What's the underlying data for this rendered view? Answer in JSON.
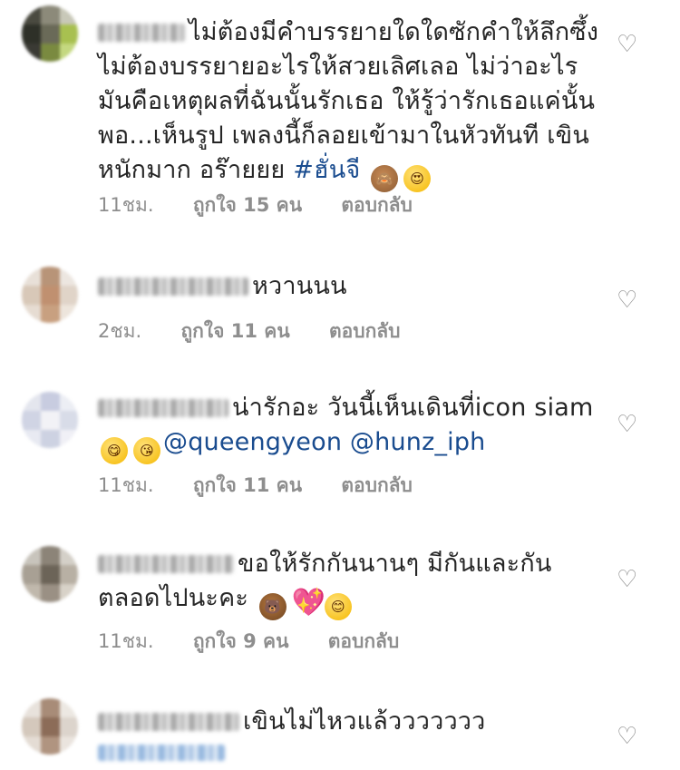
{
  "comments": [
    {
      "text": "ไม่ต้องมีคำบรรยายใดใดซักคำให้ลึกซึ้ง  ไม่ต้องบรรยายอะไรให้สวยเลิศเลอ  ไม่ว่าอะไรมันคือเหตุผลที่ฉันนั้นรักเธอ  ให้รู้ว่ารักเธอแค่นั้นพอ...เห็นรูป เพลงนี้ก็ลอยเข้ามาในหัวทันที เขินหนักมาก อร๊ายยย ",
      "hashtag": "#ฮั่นจี",
      "emojis": [
        "see-no-evil-monkey",
        "heart-eyes-face"
      ],
      "time": "11ชม.",
      "likes": "ถูกใจ 15 คน",
      "reply": "ตอบกลับ"
    },
    {
      "text": "หวานนน",
      "time": "2ชม.",
      "likes": "ถูกใจ 11 คน",
      "reply": "ตอบกลับ"
    },
    {
      "text": "น่ารักอะ วันนี้เห็นเดินที่icon siam",
      "emojis": [
        "savoring-food-face",
        "kissing-heart-face"
      ],
      "mentions": "@queengyeon @hunz_iph",
      "time": "11ชม.",
      "likes": "ถูกใจ 11 คน",
      "reply": "ตอบกลับ"
    },
    {
      "text": "ขอให้รักกันนานๆ มีกันและกันตลอดไปนะคะ",
      "emojis": [
        "bear-face",
        "sparkling-heart",
        "smiling-face"
      ],
      "time": "11ชม.",
      "likes": "ถูกใจ 9 คน",
      "reply": "ตอบกลับ"
    },
    {
      "text": "เขินไม่ไหวแล้ววววววว"
    }
  ],
  "colors": {
    "text": "#262626",
    "meta": "#8e8e8e",
    "link": "#1a4c8f"
  },
  "icons": {
    "like": "heart-outline-icon"
  }
}
